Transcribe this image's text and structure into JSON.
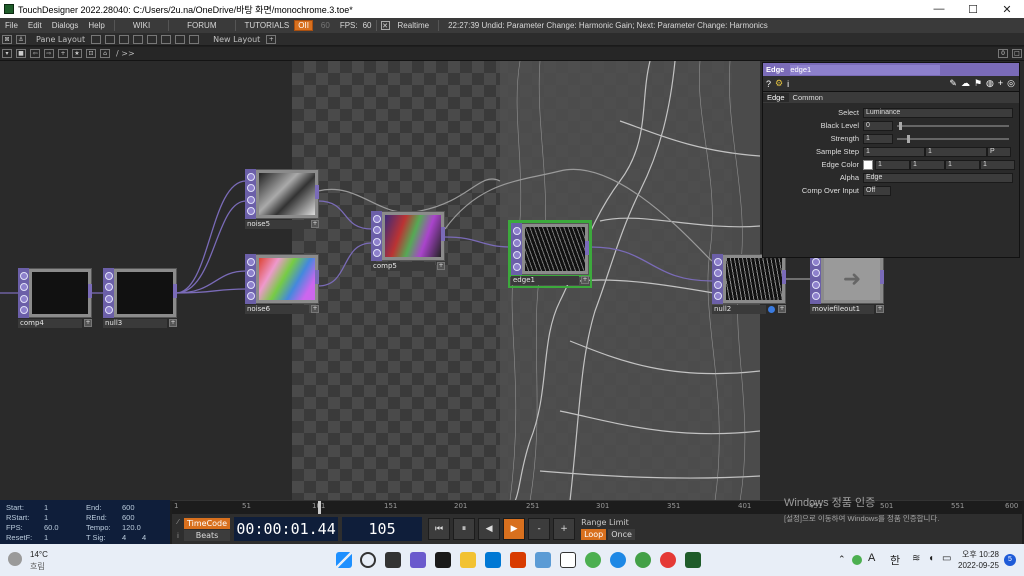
{
  "window": {
    "title": "TouchDesigner 2022.28040: C:/Users/2u.na/OneDrive/바탕 화면/monochrome.3.toe*",
    "minimize": "—",
    "maximize": "☐",
    "close": "✕"
  },
  "menu": {
    "items": [
      "File",
      "Edit",
      "Dialogs",
      "Help"
    ],
    "wiki": "WIKI",
    "forum": "FORUM",
    "tutorials": "TUTORIALS",
    "oii": "OII",
    "fps_target": "60",
    "fps_label": "FPS:",
    "fps_value": "60",
    "realtime_check": "✕",
    "realtime": "Realtime",
    "status": "22:27:39 Undid: Parameter Change: Harmonic Gain; Next: Parameter Change: Harmonics"
  },
  "panebar": {
    "pane_layout": "Pane Layout",
    "new_layout": "New Layout",
    "plus": "+",
    "path": "/ >>",
    "right_counter": "0"
  },
  "nodes": {
    "comp4": "comp4",
    "null3": "null3",
    "noise5": "noise5",
    "noise6": "noise6",
    "comp5": "comp5",
    "edge1": "edge1",
    "null2": "null2",
    "moviefileout1": "moviefileout1"
  },
  "params": {
    "op_type": "Edge",
    "op_name": "edge1",
    "tabs": [
      "Edge",
      "Common"
    ],
    "rows": [
      {
        "label": "Select",
        "value": "Luminance"
      },
      {
        "label": "Black Level",
        "value": "0"
      },
      {
        "label": "Strength",
        "value": "1"
      },
      {
        "label": "Sample Step",
        "value": "1",
        "value2": "1",
        "menu": "P"
      },
      {
        "label": "Edge Color",
        "value": "1",
        "value2": "1",
        "value3": "1",
        "value4": "1"
      },
      {
        "label": "Alpha",
        "value": "Edge"
      },
      {
        "label": "Comp Over Input",
        "value": "Off"
      }
    ]
  },
  "timeline": {
    "ticks": [
      "1",
      "51",
      "101",
      "151",
      "201",
      "251",
      "301",
      "351",
      "401",
      "451",
      "501",
      "551",
      "600"
    ]
  },
  "info": {
    "start_label": "Start:",
    "start": "1",
    "end_label": "End:",
    "end": "600",
    "rstart_label": "RStart:",
    "rstart": "1",
    "rend_label": "REnd:",
    "rend": "600",
    "fps_label": "FPS:",
    "fps": "60.0",
    "tempo_label": "Tempo:",
    "tempo": "120.0",
    "resetf_label": "ResetF:",
    "resetf": "1",
    "tsig_label": "T Sig:",
    "tsig1": "4",
    "tsig2": "4"
  },
  "transport": {
    "timecode": "TimeCode",
    "beats": "Beats",
    "time": "00:00:01.44",
    "frame": "105",
    "range_limit": "Range Limit",
    "loop": "Loop",
    "once": "Once",
    "minus": "-",
    "plus": "+"
  },
  "watermark": {
    "title": "Windows 정품 인증",
    "subtitle": "[설정]으로 이동하여 Windows를 정품 인증합니다."
  },
  "taskbar": {
    "temp": "14°C",
    "weather": "흐림",
    "ime_a": "A",
    "ime_han": "한",
    "time": "오후 10:28",
    "date": "2022-09-25",
    "notif": "5"
  },
  "colors": {
    "op_purple": "#7a6bb8",
    "accent_orange": "#d8701e",
    "selected_green": "#3caa3c"
  }
}
